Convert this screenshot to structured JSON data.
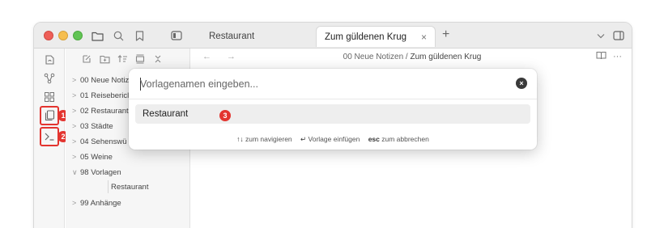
{
  "colors": {
    "accent_red": "#e3342f",
    "titlebar_bg": "#ececec",
    "sidebar_bg": "#f6f6f6",
    "suggestion_bg": "#eeeeee"
  },
  "tabs": [
    {
      "label": "Restaurant",
      "active": false
    },
    {
      "label": "Zum güldenen Krug",
      "active": true
    }
  ],
  "titlebar": {
    "icons": [
      "folder-icon",
      "search-icon",
      "bookmark-icon",
      "sidebar-toggle-icon"
    ],
    "new_tab": "+",
    "close_tab": "×",
    "right_icons": [
      "chevron-down-icon",
      "right-sidebar-icon"
    ]
  },
  "ribbon": {
    "icons": [
      "open-quick-switcher-icon",
      "graph-icon",
      "canvas-icon",
      "templates-icon",
      "command-palette-icon"
    ],
    "badges": [
      "1",
      "2"
    ]
  },
  "sidebar": {
    "tools": [
      "new-note-icon",
      "new-folder-icon",
      "sort-icon",
      "collapse-icon",
      "close-all-icon"
    ],
    "tree": [
      {
        "label": "00 Neue Notiz",
        "chev": ">"
      },
      {
        "label": "01 Reisebericl",
        "chev": ">"
      },
      {
        "label": "02 Restaurant",
        "chev": ">"
      },
      {
        "label": "03 Städte",
        "chev": ">"
      },
      {
        "label": "04 Sehenswü",
        "chev": ">"
      },
      {
        "label": "05 Weine",
        "chev": ">"
      },
      {
        "label": "98 Vorlagen",
        "chev": "∨"
      },
      {
        "label": "Restaurant",
        "chev": ""
      },
      {
        "label": "99 Anhänge",
        "chev": ">"
      }
    ]
  },
  "main": {
    "nav": "← →",
    "breadcrumb_folder": "00 Neue Notizen",
    "breadcrumb_sep": " / ",
    "breadcrumb_file": "Zum güldenen Krug",
    "actions": [
      "reading-view-icon",
      "more-options-icon"
    ],
    "more": "···"
  },
  "modal": {
    "placeholder": "Vorlagenamen eingeben...",
    "suggestion": "Restaurant",
    "suggestion_badge": "3",
    "footer": [
      {
        "key": "↑↓",
        "text": " zum navigieren"
      },
      {
        "key": "↵",
        "text": " Vorlage einfügen"
      },
      {
        "key": "esc",
        "text": " zum abbrechen"
      }
    ]
  }
}
